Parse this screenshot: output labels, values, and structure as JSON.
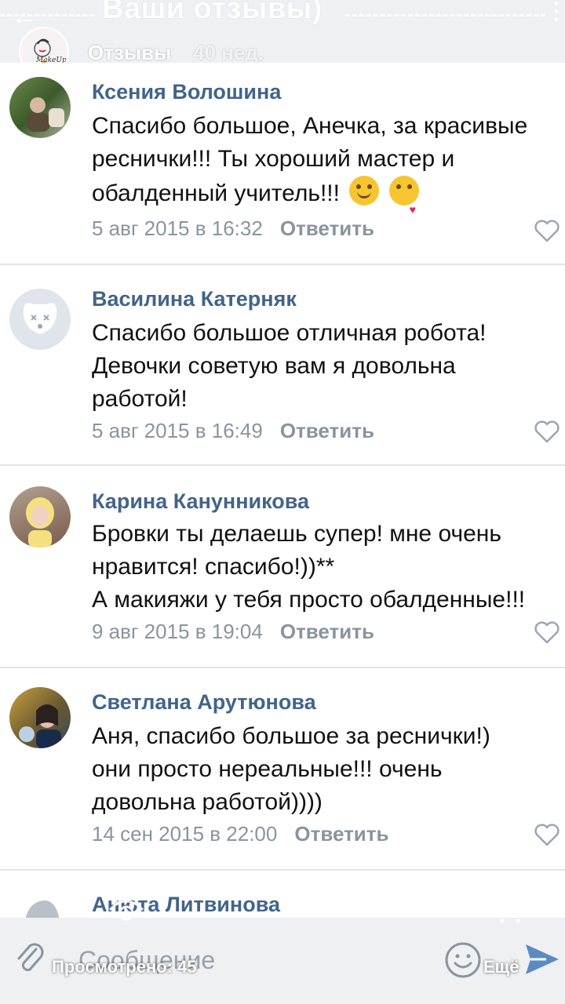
{
  "story": {
    "title": "Ваши отзывы)",
    "author": "Отзывы",
    "time": "40 нед.",
    "logo_text": "MakeUp"
  },
  "comments": [
    {
      "name": "Ксения Волошина",
      "text": "Спасибо большое, Анечка, за красивые реснички!!! Ты хороший мастер и обалденный учитель!!!",
      "date": "5 авг 2015 в 16:32",
      "reply": "Ответить"
    },
    {
      "name": "Василина Катерняк",
      "text": "Спасибо большое отличная робота! Девочки советую вам я довольна работой!",
      "date": "5 авг 2015 в 16:49",
      "reply": "Ответить"
    },
    {
      "name": "Карина Канунникова",
      "text_line1": "Бровки ты делаешь супер! мне очень нравится! спасибо!))**",
      "text_line2": "А макияжи у тебя просто обалденные!!!",
      "date": "9 авг 2015 в 19:04",
      "reply": "Ответить"
    },
    {
      "name": "Светлана Арутюнова",
      "text": "Аня, спасибо большое за реснички!) они просто нереальные!!! очень довольна работой))))",
      "date": "14 сен 2015 в 22:00",
      "reply": "Ответить"
    }
  ],
  "partial_comment": {
    "name": "Анюта Литвинова"
  },
  "composer": {
    "placeholder": "Сообщение"
  },
  "overlay": {
    "views": "Просмотрено: 45",
    "more": "Ещё"
  },
  "colors": {
    "name_blue": "#42648b",
    "meta_gray": "#8a949e",
    "heart_gray": "#9aa6b2"
  }
}
